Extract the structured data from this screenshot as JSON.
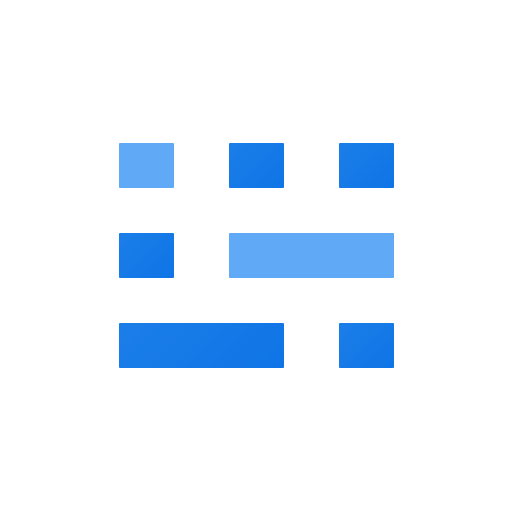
{
  "app_icon": {
    "icon_name": "keyboard-grid-icon",
    "colors": {
      "background": "#ffffff",
      "primary_blue": "#1b7ee8",
      "light_blue": "#60a9f7"
    },
    "blocks": [
      {
        "name": "top-left-key",
        "tone": "light"
      },
      {
        "name": "top-middle-key",
        "tone": "primary"
      },
      {
        "name": "top-right-key",
        "tone": "primary"
      },
      {
        "name": "middle-left-key",
        "tone": "primary"
      },
      {
        "name": "middle-wide-key",
        "tone": "light"
      },
      {
        "name": "bottom-wide-key",
        "tone": "primary"
      },
      {
        "name": "bottom-right-key",
        "tone": "primary"
      }
    ]
  }
}
